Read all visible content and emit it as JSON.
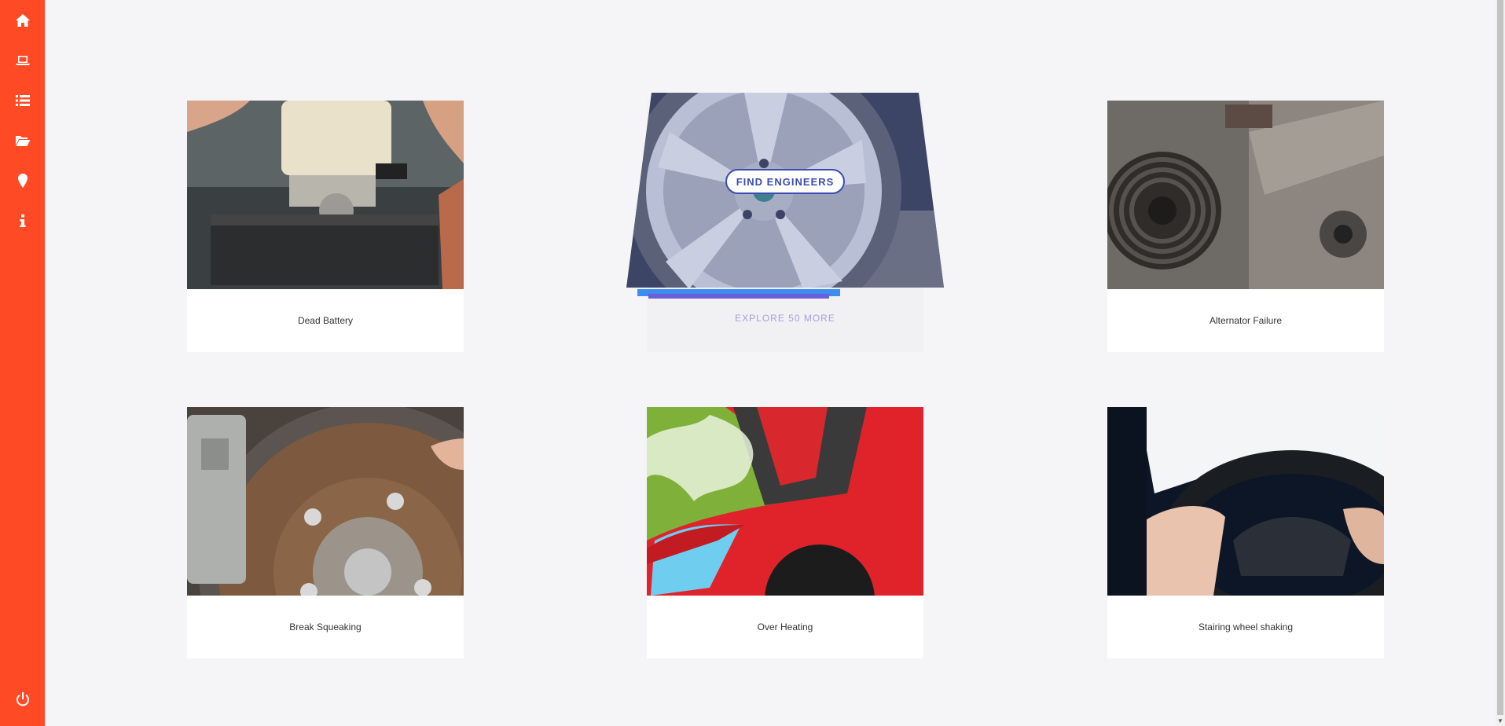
{
  "sidebar": {
    "items": [
      {
        "icon": "home-icon"
      },
      {
        "icon": "laptop-icon"
      },
      {
        "icon": "list-icon"
      },
      {
        "icon": "folder-open-icon"
      },
      {
        "icon": "map-marker-icon"
      },
      {
        "icon": "info-icon"
      }
    ],
    "logout_icon": "power-icon",
    "background": "#ff4a26"
  },
  "cards": [
    {
      "label": "Dead Battery"
    },
    {
      "featured": true,
      "button_label": "FIND ENGINEERS",
      "explore_label": "EXPLORE 50 MORE"
    },
    {
      "label": "Alternator Failure"
    },
    {
      "label": "Break Squeaking"
    },
    {
      "label": "Over Heating"
    },
    {
      "label": "Stairing wheel shaking"
    }
  ],
  "colors": {
    "accent": "#ff4a26",
    "button_border": "#3b4bb0",
    "page_background": "#f5f5f7"
  }
}
